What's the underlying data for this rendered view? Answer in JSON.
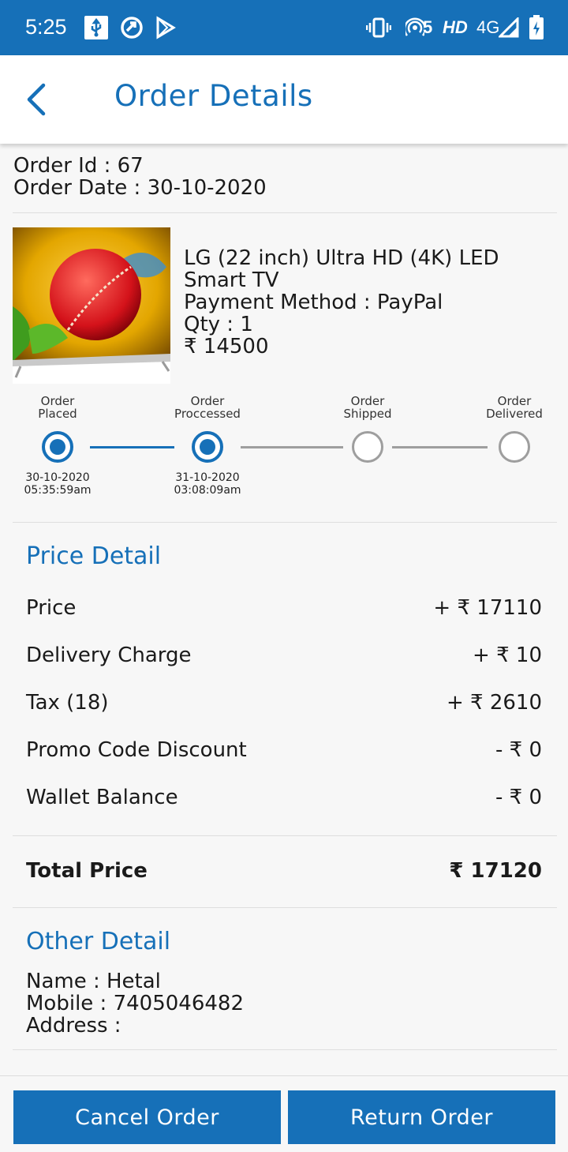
{
  "status_bar": {
    "time": "5:25",
    "network_hd": "HD",
    "network_4g": "4G",
    "hotspot_count": "5",
    "icons": [
      "usb-icon",
      "sync-icon",
      "play-store-icon",
      "vibrate-icon",
      "hotspot-icon",
      "signal-icon",
      "battery-charging-icon"
    ]
  },
  "header": {
    "title": "Order Details",
    "back_icon": "chevron-left-icon"
  },
  "order": {
    "id_line": "Order Id : 67",
    "date_line": "Order Date : 30-10-2020"
  },
  "product": {
    "name": "LG (22 inch) Ultra HD (4K) LED Smart TV",
    "payment_line": "Payment Method : PayPal",
    "qty_line": "Qty : 1",
    "price_line": "₹ 14500"
  },
  "tracking": {
    "steps": [
      {
        "label_1": "Order",
        "label_2": "Placed",
        "date": "30-10-2020",
        "time": "05:35:59am",
        "done": true
      },
      {
        "label_1": "Order",
        "label_2": "Proccessed",
        "date": "31-10-2020",
        "time": "03:08:09am",
        "done": true
      },
      {
        "label_1": "Order",
        "label_2": "Shipped",
        "date": "",
        "time": "",
        "done": false
      },
      {
        "label_1": "Order",
        "label_2": "Delivered",
        "date": "",
        "time": "",
        "done": false
      }
    ]
  },
  "price_detail": {
    "title": "Price Detail",
    "rows": [
      {
        "label": "Price",
        "value": "+ ₹ 17110"
      },
      {
        "label": "Delivery Charge",
        "value": "+ ₹ 10"
      },
      {
        "label": "Tax (18)",
        "value": "+ ₹ 2610"
      },
      {
        "label": "Promo Code Discount",
        "value": "- ₹ 0"
      },
      {
        "label": "Wallet Balance",
        "value": "- ₹ 0"
      }
    ],
    "total_label": "Total Price",
    "total_value": "₹ 17120"
  },
  "other_detail": {
    "title": "Other Detail",
    "name_line": "Name : Hetal",
    "mobile_line": "Mobile : 7405046482",
    "address_line": "Address :"
  },
  "actions": {
    "cancel_label": "Cancel Order",
    "return_label": "Return Order"
  },
  "colors": {
    "primary": "#1670b8",
    "inactive": "#9e9e9e",
    "background": "#f7f7f7"
  }
}
